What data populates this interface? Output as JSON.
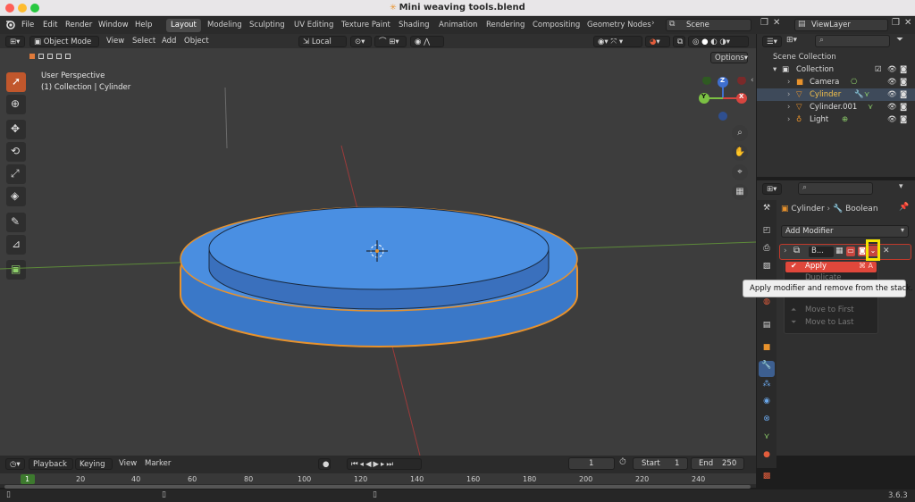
{
  "window": {
    "title": "Mini weaving tools.blend",
    "title_icon": "blend-file-icon"
  },
  "menu": [
    "File",
    "Edit",
    "Render",
    "Window",
    "Help"
  ],
  "workspaces": [
    "Layout",
    "Modeling",
    "Sculpting",
    "UV Editing",
    "Texture Paint",
    "Shading",
    "Animation",
    "Rendering",
    "Compositing",
    "Geometry Nodes"
  ],
  "active_workspace": "Layout",
  "scene": {
    "label": "Scene",
    "view_layer": "ViewLayer"
  },
  "viewport_header": {
    "mode": "Object Mode",
    "menus": [
      "View",
      "Select",
      "Add",
      "Object"
    ],
    "transform": "Local",
    "options": "Options"
  },
  "overlay_text": {
    "line1": "User Perspective",
    "line2": "(1) Collection | Cylinder"
  },
  "gizmo": {
    "x": "X",
    "y": "Y",
    "z": "Z"
  },
  "outliner": {
    "scene_collection": "Scene Collection",
    "items": [
      {
        "label": "Collection",
        "icon": "collection-icon",
        "selected": false
      },
      {
        "label": "Camera",
        "icon": "camera-icon",
        "selected": false
      },
      {
        "label": "Cylinder",
        "icon": "mesh-icon",
        "selected": true
      },
      {
        "label": "Cylinder.001",
        "icon": "mesh-icon",
        "selected": false
      },
      {
        "label": "Light",
        "icon": "light-icon",
        "selected": false
      }
    ]
  },
  "properties": {
    "breadcrumb_object": "Cylinder",
    "breadcrumb_modifier": "Boolean",
    "add_modifier": "Add Modifier",
    "modifier_name": "B..."
  },
  "context_menu": {
    "apply": "Apply",
    "apply_shortcut": "⌘ A",
    "duplicate": "Duplicate",
    "move_first": "Move to First",
    "move_last": "Move to Last",
    "tooltip": "Apply modifier and remove from the stack."
  },
  "timeline": {
    "playback": "Playback",
    "keying": "Keying",
    "view": "View",
    "marker": "Marker",
    "current_frame": "1",
    "start_label": "Start",
    "start": "1",
    "end_label": "End",
    "end": "250",
    "ruler": [
      "1",
      "20",
      "40",
      "60",
      "80",
      "100",
      "120",
      "140",
      "160",
      "180",
      "200",
      "220",
      "240"
    ]
  },
  "status": {
    "version": "3.6.3"
  },
  "colors": {
    "accent_orange": "#e87d0d",
    "highlight_yellow": "#f5e400",
    "menu_red": "#e0473b",
    "mesh_blue": "#4a90e2"
  }
}
